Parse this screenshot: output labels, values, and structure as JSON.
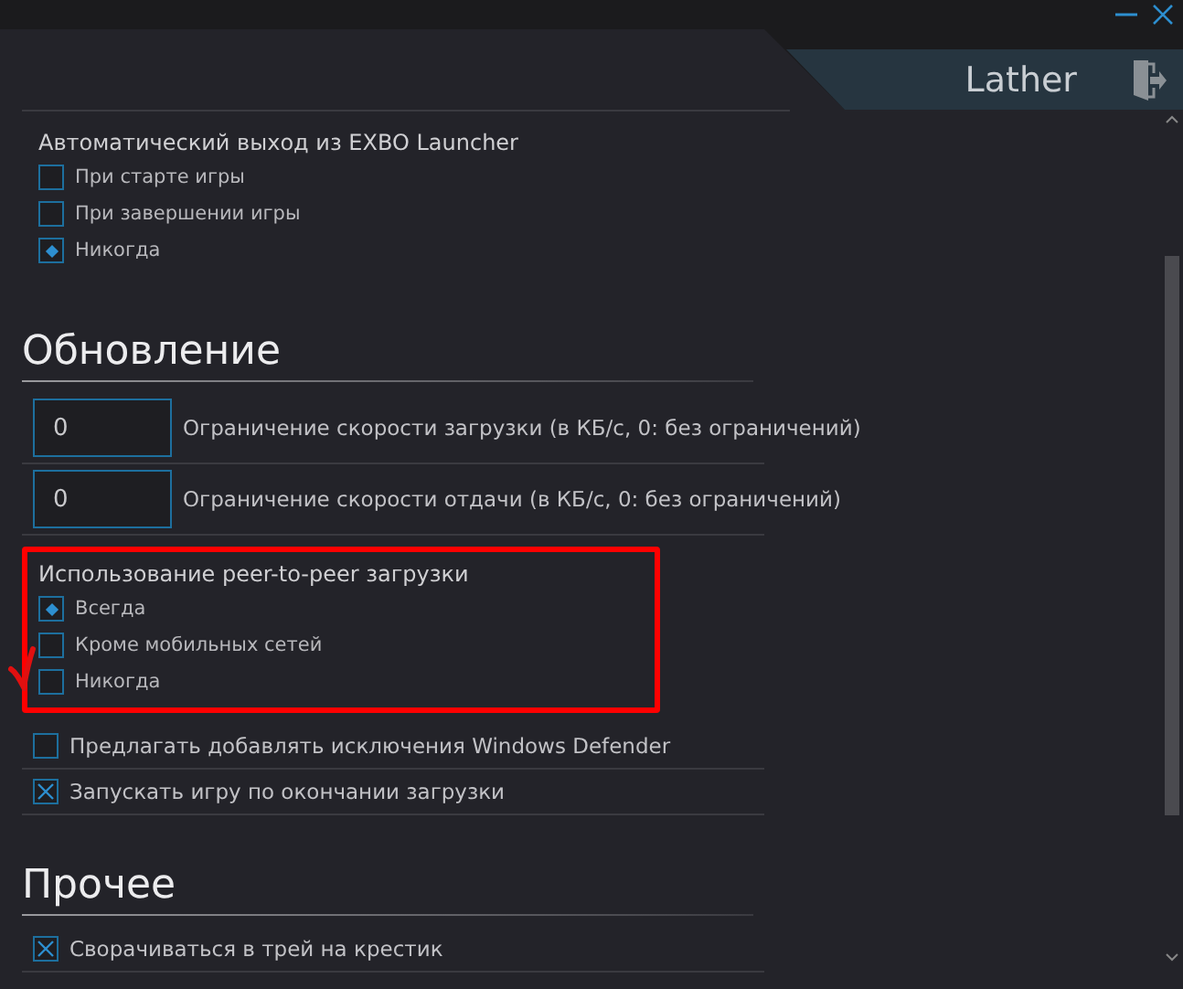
{
  "account": {
    "name": "Lather"
  },
  "items": [
    {
      "kind": "radio-group",
      "title": "Автоматический выход из EXBO Launcher",
      "highlighted": false,
      "options": [
        {
          "label": "При старте игры",
          "selected": false
        },
        {
          "label": "При завершении игры",
          "selected": false
        },
        {
          "label": "Никогда",
          "selected": true
        }
      ]
    },
    {
      "kind": "heading",
      "title": "Обновление"
    },
    {
      "kind": "number",
      "value": "0",
      "label": "Ограничение скорости загрузки (в КБ/с, 0: без ограничений)"
    },
    {
      "kind": "number",
      "value": "0",
      "label": "Ограничение скорости отдачи (в КБ/с, 0: без ограничений)"
    },
    {
      "kind": "radio-group",
      "title": "Использование peer-to-peer загрузки",
      "highlighted": true,
      "options": [
        {
          "label": "Всегда",
          "selected": true
        },
        {
          "label": "Кроме мобильных сетей",
          "selected": false
        },
        {
          "label": "Никогда",
          "selected": false
        }
      ]
    },
    {
      "kind": "checkbox",
      "label": "Предлагать добавлять исключения Windows Defender",
      "checked": false
    },
    {
      "kind": "checkbox",
      "label": "Запускать игру по окончании загрузки",
      "checked": true
    },
    {
      "kind": "heading",
      "title": "Прочее"
    },
    {
      "kind": "checkbox",
      "label": "Сворачиваться в трей на крестик",
      "checked": true
    }
  ]
}
